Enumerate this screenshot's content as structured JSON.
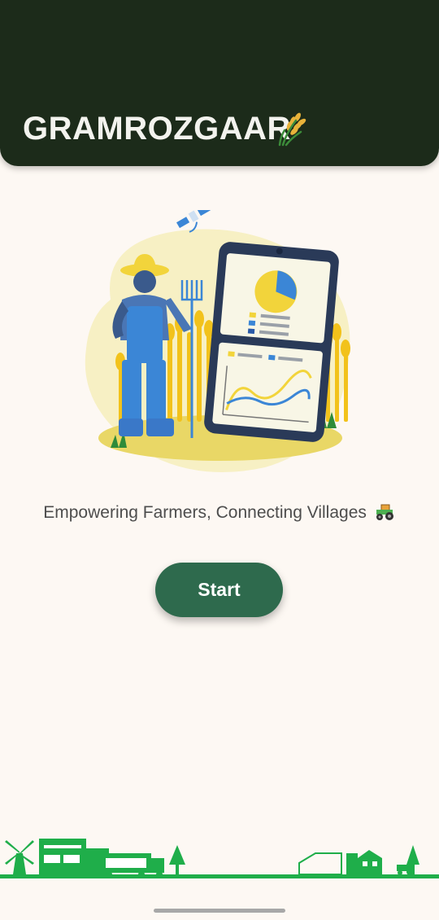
{
  "app": {
    "title": "GRAMROZGAAR",
    "title_icon": "wheat-sheaf-icon"
  },
  "hero": {
    "illustration": "farmer-with-tablet-illustration"
  },
  "tagline": {
    "text": "Empowering Farmers, Connecting Villages",
    "icon": "tractor-icon"
  },
  "actions": {
    "start_label": "Start"
  },
  "colors": {
    "header_bg": "#1c2b1a",
    "page_bg": "#fdf8f3",
    "button_bg": "#2e6a4d",
    "footer_green": "#1fae4a"
  }
}
